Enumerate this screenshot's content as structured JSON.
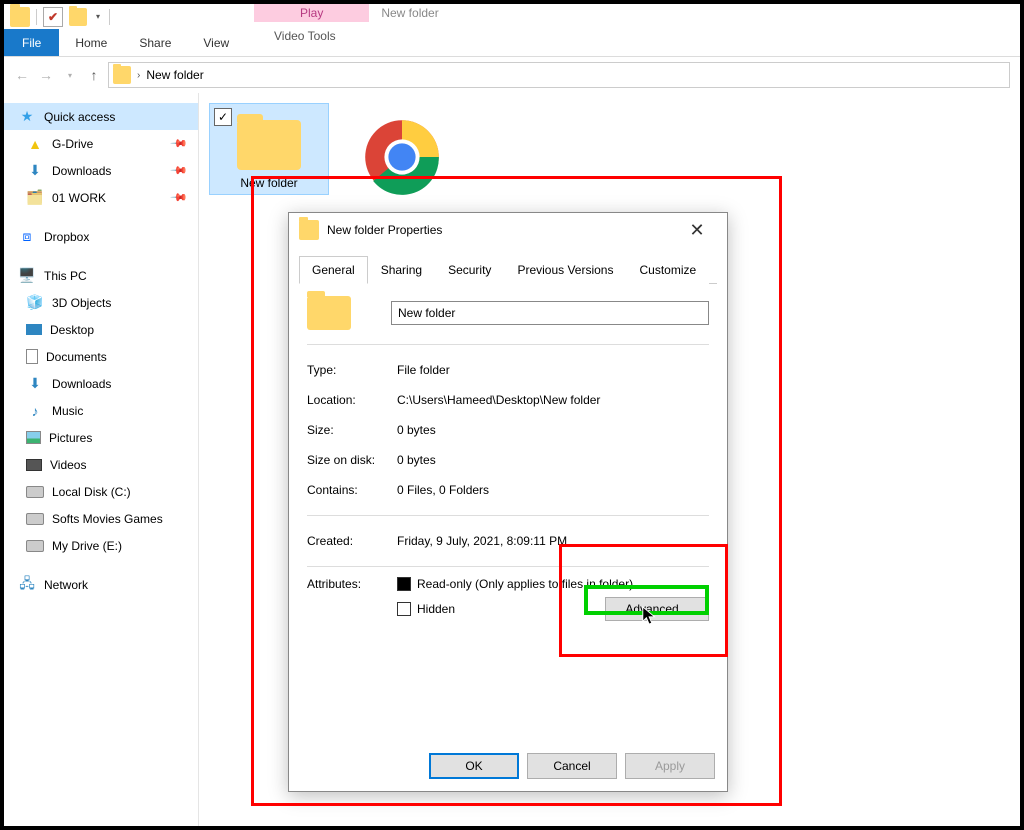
{
  "titlebar": {
    "contextual_tab": "Play",
    "window_title": "New folder"
  },
  "ribbon": {
    "file": "File",
    "home": "Home",
    "share": "Share",
    "view": "View",
    "video_tools": "Video Tools"
  },
  "breadcrumb": {
    "path": "New folder"
  },
  "navpane": {
    "quick_access": "Quick access",
    "gdrive": "G-Drive",
    "downloads": "Downloads",
    "work": "01 WORK",
    "dropbox": "Dropbox",
    "this_pc": "This PC",
    "objects3d": "3D Objects",
    "desktop": "Desktop",
    "documents": "Documents",
    "downloads2": "Downloads",
    "music": "Music",
    "pictures": "Pictures",
    "videos": "Videos",
    "localdisk": "Local Disk (C:)",
    "softs": "Softs Movies Games",
    "mydrive": "My Drive (E:)",
    "network": "Network"
  },
  "files": {
    "item1": "New folder",
    "item2": "Chrome"
  },
  "dialog": {
    "title": "New folder Properties",
    "tabs": {
      "general": "General",
      "sharing": "Sharing",
      "security": "Security",
      "prev": "Previous Versions",
      "custom": "Customize"
    },
    "name": "New folder",
    "type_lbl": "Type:",
    "type_val": "File folder",
    "loc_lbl": "Location:",
    "loc_val": "C:\\Users\\Hameed\\Desktop\\New folder",
    "size_lbl": "Size:",
    "size_val": "0 bytes",
    "disk_lbl": "Size on disk:",
    "disk_val": "0 bytes",
    "cont_lbl": "Contains:",
    "cont_val": "0 Files, 0 Folders",
    "created_lbl": "Created:",
    "created_val": "Friday, 9 July, 2021, 8:09:11 PM",
    "attr_lbl": "Attributes:",
    "readonly": "Read-only (Only applies to files in folder)",
    "hidden": "Hidden",
    "advanced": "Advanced...",
    "ok": "OK",
    "cancel": "Cancel",
    "apply": "Apply"
  }
}
